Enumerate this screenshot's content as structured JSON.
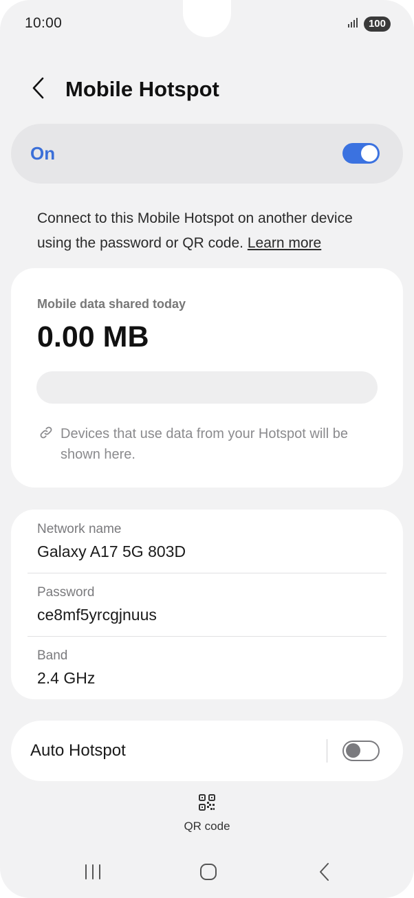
{
  "status_bar": {
    "time": "10:00",
    "battery": "100",
    "icons": [
      "signal-icon"
    ]
  },
  "header": {
    "title": "Mobile Hotspot",
    "back_icon": "chevron-left-icon"
  },
  "master_switch": {
    "label": "On",
    "state": true,
    "accent_color": "#3b72e0"
  },
  "description": {
    "text": "Connect to this Mobile Hotspot on another device using the password or QR code.",
    "link": "Learn more"
  },
  "data_usage": {
    "label": "Mobile data shared today",
    "value": "0.00 MB",
    "progress_fraction": 0,
    "empty_text": "Devices that use data from your Hotspot will be shown here.",
    "icon": "link-icon"
  },
  "network": {
    "rows": [
      {
        "label": "Network name",
        "value": "Galaxy A17 5G 803D"
      },
      {
        "label": "Password",
        "value": "ce8mf5yrcgjnuus"
      },
      {
        "label": "Band",
        "value": "2.4 GHz"
      }
    ]
  },
  "auto_hotspot": {
    "label": "Auto Hotspot",
    "state": false
  },
  "qr": {
    "label": "QR code",
    "icon": "qr-code-icon"
  },
  "nav": {
    "icons": [
      "recents-icon",
      "home-icon",
      "back-icon"
    ]
  }
}
